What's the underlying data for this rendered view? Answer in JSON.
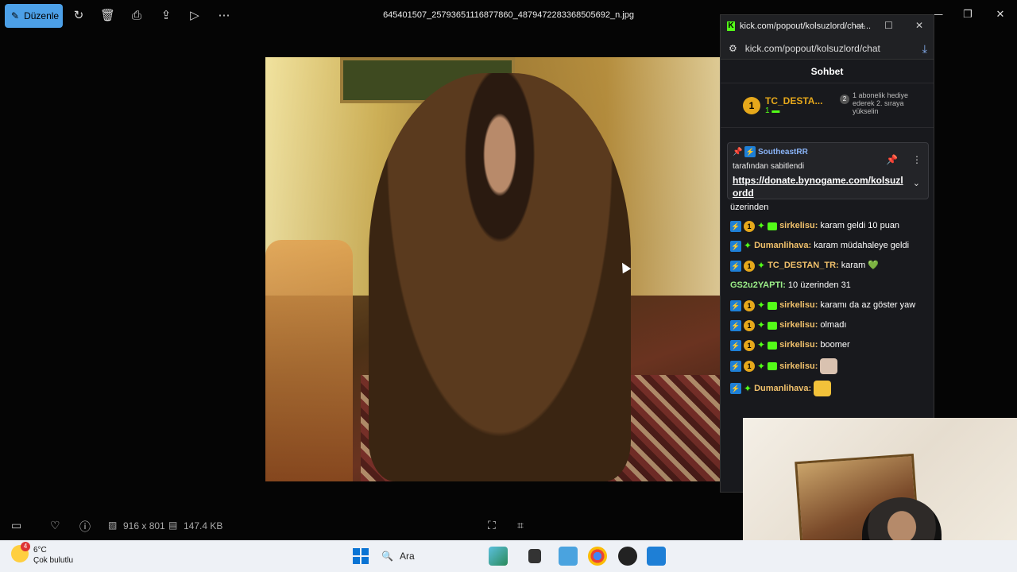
{
  "photos_app": {
    "edit_label": "Düzenle",
    "filename": "645401507_25793651116877860_4879472283368505692_n.jpg",
    "toolbar_icons": [
      "rotate-icon",
      "delete-icon",
      "print-icon",
      "share-icon",
      "slideshow-icon",
      "more-icon"
    ],
    "dimensions": "916 x 801",
    "filesize": "147.4 KB"
  },
  "chat_window": {
    "title": "kick.com/popout/kolsuzlord/chat...",
    "url": "kick.com/popout/kolsuzlord/chat",
    "header": "Sohbet",
    "leader": {
      "rank": "1",
      "name": "TC_DESTA...",
      "count": "1"
    },
    "hint": {
      "num": "2",
      "text": "1 abonelik hediye ederek 2. sıraya yükselin"
    },
    "pinned": {
      "user": "SoutheastRR",
      "by_text": "tarafından sabitlendi",
      "link": "https://donate.bynogame.com/kolsuzlordd"
    },
    "overflow_text": "üzerinden",
    "messages": [
      {
        "user": "sirkelisu",
        "color": "#f0c06b",
        "badges": [
          "blue",
          "gold",
          "green",
          "sub"
        ],
        "text": "karam geldi 10 puan"
      },
      {
        "user": "Dumanlihava",
        "color": "#f0c06b",
        "badges": [
          "blue",
          "green"
        ],
        "text": "karam müdahaleye geldi"
      },
      {
        "user": "TC_DESTAN_TR",
        "color": "#f0c06b",
        "badges": [
          "blue",
          "gold",
          "green"
        ],
        "text": "karam 💚"
      },
      {
        "user": "GS2u2YAPTI",
        "color": "#9cf089",
        "badges": [],
        "text": "10 üzerinden 31"
      },
      {
        "user": "sirkelisu",
        "color": "#f0c06b",
        "badges": [
          "blue",
          "gold",
          "green",
          "sub"
        ],
        "text": "karamı da az göster yaw"
      },
      {
        "user": "sirkelisu",
        "color": "#f0c06b",
        "badges": [
          "blue",
          "gold",
          "green",
          "sub"
        ],
        "text": "olmadı"
      },
      {
        "user": "sirkelisu",
        "color": "#f0c06b",
        "badges": [
          "blue",
          "gold",
          "green",
          "sub"
        ],
        "text": "boomer"
      },
      {
        "user": "sirkelisu",
        "color": "#f0c06b",
        "badges": [
          "blue",
          "gold",
          "green",
          "sub"
        ],
        "text": "",
        "emote": "cat-emote"
      },
      {
        "user": "Dumanlihava",
        "color": "#f0c06b",
        "badges": [
          "blue",
          "green"
        ],
        "text": "",
        "emote": "cool-emote"
      }
    ]
  },
  "taskbar": {
    "weather_temp": "6°C",
    "weather_desc": "Çok bulutlu",
    "weather_badge": "4",
    "search_label": "Ara"
  }
}
